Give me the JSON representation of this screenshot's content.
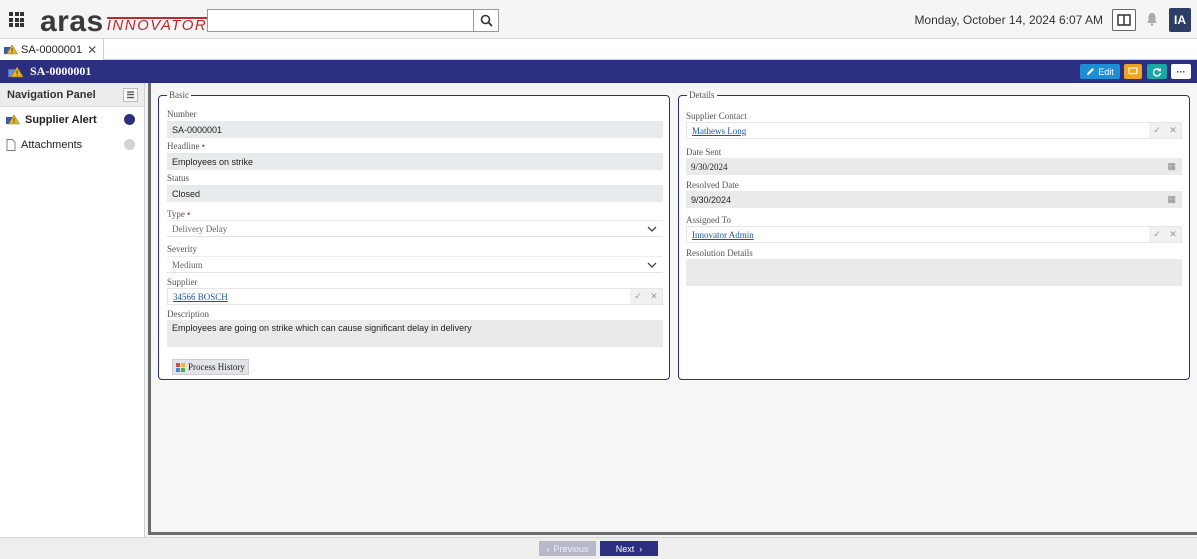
{
  "app": {
    "logo_main": "aras",
    "logo_sub": "INNOVATOR",
    "datetime": "Monday, October 14, 2024 6:07 AM",
    "user_initials": "IA",
    "search": {
      "value": "",
      "placeholder": ""
    }
  },
  "tabs": [
    {
      "label": "SA-0000001"
    }
  ],
  "titlebar": {
    "title": "SA-0000001",
    "edit_label": "Edit"
  },
  "nav": {
    "header": "Navigation Panel",
    "items": [
      {
        "label": "Supplier Alert",
        "status_color": "#2c2f7f"
      },
      {
        "label": "Attachments",
        "status_color": "#d4d4d4"
      }
    ]
  },
  "basic": {
    "legend": "Basic",
    "number_label": "Number",
    "number_value": "SA-0000001",
    "headline_label": "Headline",
    "headline_value": "Employees on strike",
    "status_label": "Status",
    "status_value": "Closed",
    "type_label": "Type",
    "type_value": "Delivery Delay",
    "severity_label": "Severity",
    "severity_value": "Medium",
    "supplier_label": "Supplier",
    "supplier_value": "34566 BOSCH",
    "description_label": "Description",
    "description_value": "Employees are going on strike which can cause significant delay in delivery",
    "process_history_label": "Process History"
  },
  "details": {
    "legend": "Details",
    "contact_label": "Supplier Contact",
    "contact_value": "Mathews Long",
    "date_sent_label": "Date Sent",
    "date_sent_value": "9/30/2024",
    "resolved_date_label": "Resolved Date",
    "resolved_date_value": "9/30/2024",
    "assigned_label": "Assigned To",
    "assigned_value": "Innovator Admin",
    "resolution_label": "Resolution Details",
    "resolution_value": ""
  },
  "footer": {
    "previous_label": "Previous",
    "next_label": "Next"
  },
  "colors": {
    "brand_navy": "#2c2f7f",
    "edit_blue": "#1e8fd6",
    "discussion_orange": "#f0a422",
    "refresh_teal": "#1ca6a6",
    "logo_red": "#c0282d"
  }
}
